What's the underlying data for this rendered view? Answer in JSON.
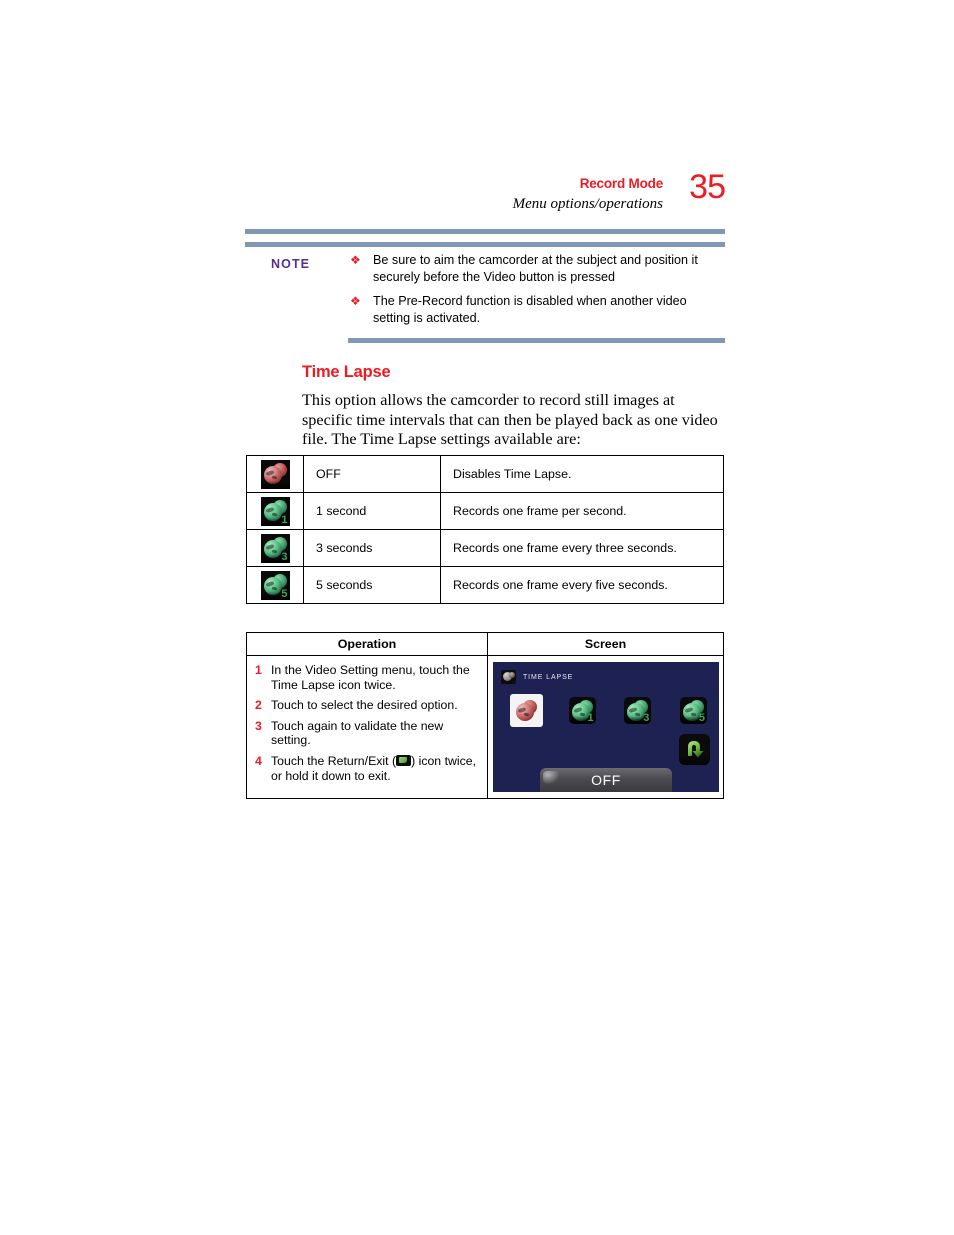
{
  "header": {
    "chapter": "Record Mode",
    "section": "Menu options/operations",
    "page_number": "35"
  },
  "note": {
    "label": "NOTE",
    "bullet_glyph": "❖",
    "items": [
      "Be sure to aim the camcorder at the subject and position it securely before the Video button is pressed",
      "The Pre-Record function is disabled when another video setting is activated."
    ]
  },
  "section": {
    "heading": "Time Lapse",
    "paragraph": "This option allows the camcorder to record still images at specific time intervals that can then be played back as one video file. The Time Lapse settings available are:"
  },
  "settings_table": {
    "rows": [
      {
        "icon": "time-lapse-off-icon",
        "icon_badge": "",
        "name": "OFF",
        "description": "Disables Time Lapse."
      },
      {
        "icon": "time-lapse-1-second-icon",
        "icon_badge": "1",
        "name": "1 second",
        "description": "Records one frame per second."
      },
      {
        "icon": "time-lapse-3-seconds-icon",
        "icon_badge": "3",
        "name": "3 seconds",
        "description": "Records one frame every three seconds."
      },
      {
        "icon": "time-lapse-5-seconds-icon",
        "icon_badge": "5",
        "name": "5 seconds",
        "description": "Records one frame every five seconds."
      }
    ]
  },
  "operation_table": {
    "headers": {
      "operation": "Operation",
      "screen": "Screen"
    },
    "steps": [
      {
        "number": "1",
        "text_before": "In the Video Setting menu, touch the Time Lapse icon twice.",
        "text_after": ""
      },
      {
        "number": "2",
        "text_before": "Touch to select the desired option.",
        "text_after": ""
      },
      {
        "number": "3",
        "text_before": "Touch again to validate the new setting.",
        "text_after": ""
      },
      {
        "number": "4",
        "text_before": "Touch the Return/Exit (",
        "text_after": ") icon twice, or hold it down to exit."
      }
    ]
  },
  "screen_mock": {
    "title": "TIME LAPSE",
    "options": [
      {
        "badge": "",
        "selected": true,
        "name": "off-option"
      },
      {
        "badge": "1",
        "selected": false,
        "name": "one-second-option"
      },
      {
        "badge": "3",
        "selected": false,
        "name": "three-seconds-option"
      },
      {
        "badge": "5",
        "selected": false,
        "name": "five-seconds-option"
      }
    ],
    "return_icon": "return-exit-icon",
    "selected_value": "OFF"
  },
  "colors": {
    "accent_red": "#ED1C24",
    "note_purple": "#5B2D8E",
    "rule_slate": "#8098B4",
    "screen_navy": "#1D2253",
    "icon_green": "#59BD85"
  }
}
